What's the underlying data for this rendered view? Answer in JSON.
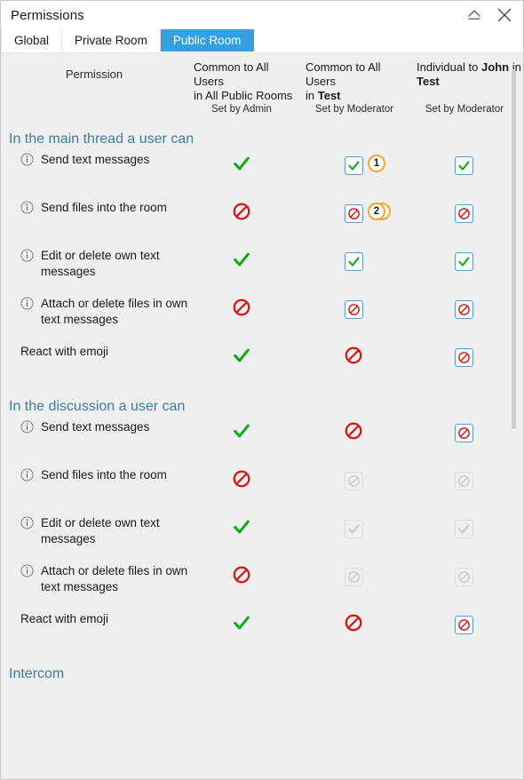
{
  "window": {
    "title": "Permissions",
    "buttons": [
      {
        "name": "collapse-button",
        "icon": "eject-icon",
        "label": "Collapse"
      },
      {
        "name": "close-button",
        "icon": "close-icon",
        "label": "Close"
      }
    ]
  },
  "tabs": [
    {
      "label": "Global",
      "active": false
    },
    {
      "label": "Private Room",
      "active": false
    },
    {
      "label": "Public Room",
      "active": true
    }
  ],
  "colors": {
    "accent": "#35a0e0",
    "section_heading": "#3b7ca6",
    "allow_green": "#15a815",
    "deny_red": "#dd1111",
    "badge_orange": "#f5a623",
    "checkbox_border": "#5a9ad4",
    "pane_background": "#efefef",
    "disabled_gray": "#c9c9c9"
  },
  "header": {
    "permission_label": "Permission",
    "columns": [
      {
        "title_lines": [
          "Common to All Users",
          "in All Public Rooms"
        ],
        "bold_words": [],
        "subtitle": "Set by Admin"
      },
      {
        "title_lines": [
          "Common to All Users",
          "in Test"
        ],
        "bold_words": [
          "Test"
        ],
        "subtitle": "Set by Moderator"
      },
      {
        "title_lines": [
          "Individual to John in",
          "Test"
        ],
        "bold_words": [
          "John",
          "Test"
        ],
        "subtitle": "Set by Moderator"
      }
    ]
  },
  "sections": [
    {
      "title": "In the main thread a user can",
      "rows": [
        {
          "label": "Send text messages",
          "has_info": true,
          "cells": [
            {
              "type": "check-plain",
              "state": "allowed"
            },
            {
              "type": "check-box",
              "state": "allowed",
              "badge": "1"
            },
            {
              "type": "check-box",
              "state": "allowed"
            }
          ]
        },
        {
          "label": "Send files into the room",
          "has_info": true,
          "cells": [
            {
              "type": "deny-plain",
              "state": "denied",
              "badge": "3"
            },
            {
              "type": "deny-box",
              "state": "denied",
              "badge": "2"
            },
            {
              "type": "deny-box",
              "state": "denied"
            }
          ]
        },
        {
          "label": "Edit or delete own text messages",
          "has_info": true,
          "cells": [
            {
              "type": "check-plain",
              "state": "allowed"
            },
            {
              "type": "check-box",
              "state": "allowed"
            },
            {
              "type": "check-box",
              "state": "allowed"
            }
          ]
        },
        {
          "label": "Attach or delete files in own text messages",
          "has_info": true,
          "cells": [
            {
              "type": "deny-plain",
              "state": "denied"
            },
            {
              "type": "deny-box",
              "state": "denied"
            },
            {
              "type": "deny-box",
              "state": "denied"
            }
          ]
        },
        {
          "label": "React with emoji",
          "has_info": false,
          "cells": [
            {
              "type": "check-plain",
              "state": "allowed"
            },
            {
              "type": "deny-plain",
              "state": "denied"
            },
            {
              "type": "deny-box",
              "state": "denied"
            }
          ]
        }
      ]
    },
    {
      "title": "In the discussion a user can",
      "rows": [
        {
          "label": "Send text messages",
          "has_info": true,
          "cells": [
            {
              "type": "check-plain",
              "state": "allowed"
            },
            {
              "type": "deny-plain",
              "state": "denied"
            },
            {
              "type": "deny-box",
              "state": "denied"
            }
          ]
        },
        {
          "label": "Send files into the room",
          "has_info": true,
          "cells": [
            {
              "type": "deny-plain",
              "state": "denied"
            },
            {
              "type": "deny-box",
              "state": "disabled"
            },
            {
              "type": "deny-box",
              "state": "disabled"
            }
          ]
        },
        {
          "label": "Edit or delete own text messages",
          "has_info": true,
          "cells": [
            {
              "type": "check-plain",
              "state": "allowed"
            },
            {
              "type": "check-box",
              "state": "disabled"
            },
            {
              "type": "check-box",
              "state": "disabled"
            }
          ]
        },
        {
          "label": "Attach or delete files in own text messages",
          "has_info": true,
          "cells": [
            {
              "type": "deny-plain",
              "state": "denied"
            },
            {
              "type": "deny-box",
              "state": "disabled"
            },
            {
              "type": "deny-box",
              "state": "disabled"
            }
          ]
        },
        {
          "label": "React with emoji",
          "has_info": false,
          "cells": [
            {
              "type": "check-plain",
              "state": "allowed"
            },
            {
              "type": "deny-plain",
              "state": "denied"
            },
            {
              "type": "deny-box",
              "state": "denied"
            }
          ]
        }
      ]
    },
    {
      "title": "Intercom",
      "rows": []
    }
  ]
}
